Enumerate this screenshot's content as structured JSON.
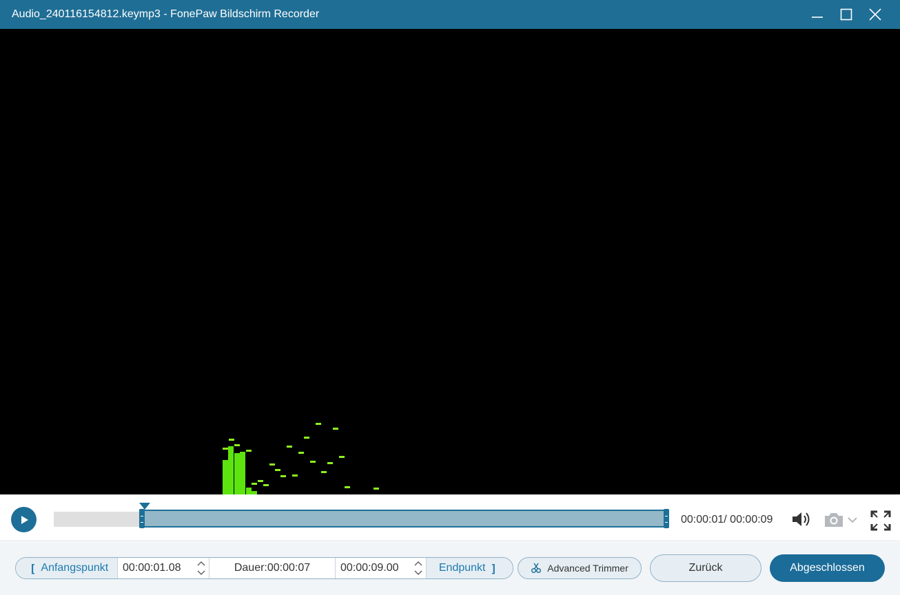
{
  "window": {
    "title": "Audio_240116154812.keymp3  -  FonePaw Bildschirm Recorder",
    "controls": [
      "minimize",
      "maximize",
      "close"
    ]
  },
  "player": {
    "current_time": "00:00:01",
    "total_time": "00:00:09",
    "time_display": "00:00:01/ 00:00:09",
    "selection_start_fraction": 0.14,
    "selection_end_fraction": 1.0,
    "playhead_fraction": 0.14,
    "icons": [
      "play-icon",
      "volume-icon",
      "camera-icon",
      "chevron-down-icon",
      "fullscreen-icon"
    ]
  },
  "trim": {
    "start_label": "Anfangspunkt",
    "start_time": "00:00:01.08",
    "duration_text": "Dauer:00:00:07",
    "end_time": "00:00:09.00",
    "end_label": "Endpunkt"
  },
  "buttons": {
    "advanced_trimmer": "Advanced Trimmer",
    "back": "Zurück",
    "done": "Abgeschlossen"
  },
  "colors": {
    "accent": "#1f6e95",
    "visualizer": "#5de30e",
    "video_background": "#000000"
  }
}
